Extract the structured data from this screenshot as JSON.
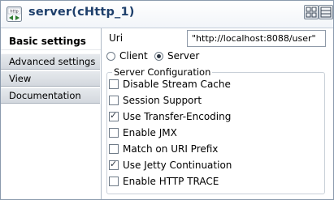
{
  "header": {
    "icon_label": "http",
    "title": "server(cHttp_1)"
  },
  "tabs": [
    {
      "label": "Basic settings",
      "active": true
    },
    {
      "label": "Advanced settings",
      "active": false
    },
    {
      "label": "View",
      "active": false
    },
    {
      "label": "Documentation",
      "active": false
    }
  ],
  "uri": {
    "label": "Uri",
    "value": "\"http://localhost:8088/user\""
  },
  "mode": {
    "options": [
      {
        "label": "Client",
        "selected": false
      },
      {
        "label": "Server",
        "selected": true
      }
    ]
  },
  "server_config": {
    "title": "Server Configuration",
    "options": [
      {
        "label": "Disable Stream Cache",
        "checked": false
      },
      {
        "label": "Session Support",
        "checked": false
      },
      {
        "label": "Use Transfer-Encoding",
        "checked": true
      },
      {
        "label": "Enable JMX",
        "checked": false
      },
      {
        "label": "Match on URI Prefix",
        "checked": false
      },
      {
        "label": "Use Jetty Continuation",
        "checked": true
      },
      {
        "label": "Enable HTTP TRACE",
        "checked": false
      }
    ]
  },
  "colors": {
    "title": "#1e3f6b",
    "tab_bg": "#dcdfe4",
    "border": "#8a9aad"
  }
}
